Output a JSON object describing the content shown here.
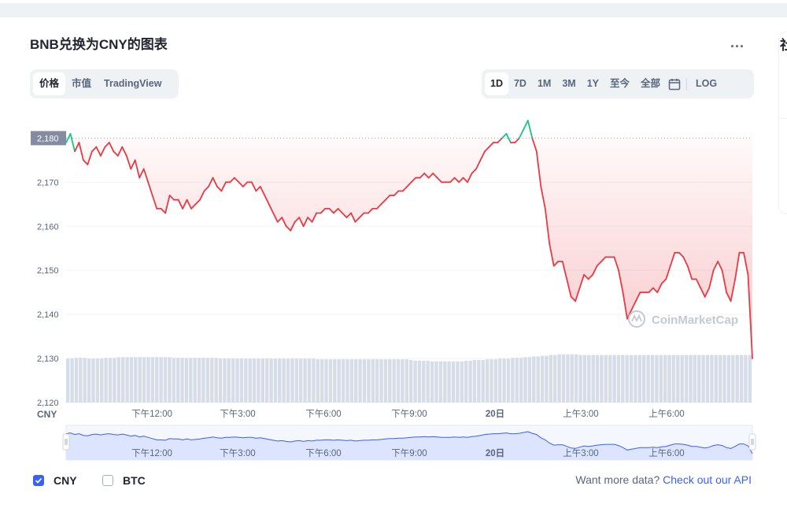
{
  "header": {
    "title": "BNB兑换为CNY的图表",
    "more_label": "..."
  },
  "view_tabs": [
    {
      "label": "价格",
      "active": true
    },
    {
      "label": "市值",
      "active": false
    },
    {
      "label": "TradingView",
      "active": false
    }
  ],
  "range_tabs": [
    {
      "label": "1D",
      "active": true
    },
    {
      "label": "7D",
      "active": false
    },
    {
      "label": "1M",
      "active": false
    },
    {
      "label": "3M",
      "active": false
    },
    {
      "label": "1Y",
      "active": false
    },
    {
      "label": "至今",
      "active": false
    },
    {
      "label": "全部",
      "active": false
    }
  ],
  "calendar_icon": "calendar-icon",
  "log_label": "LOG",
  "right_panel_title": "社",
  "footer": {
    "cny_label": "CNY",
    "btc_label": "BTC",
    "cny_checked": true,
    "btc_checked": false,
    "api_text": "Want more data? ",
    "api_link": "Check out our API"
  },
  "chart_data": {
    "type": "line",
    "watermark": "CoinMarketCap",
    "y_unit_label": "CNY",
    "ylim": [
      2120,
      2184
    ],
    "reference_value": 2180,
    "reference_label": "2,180",
    "y_ticks": [
      {
        "value": 2170,
        "label": "2,170"
      },
      {
        "value": 2160,
        "label": "2,160"
      },
      {
        "value": 2150,
        "label": "2,150"
      },
      {
        "value": 2140,
        "label": "2,140"
      },
      {
        "value": 2130,
        "label": "2,130"
      },
      {
        "value": 2120,
        "label": "2,120"
      }
    ],
    "x_ticks": [
      "下午12:00",
      "下午3:00",
      "下午6:00",
      "下午9:00",
      "20日",
      "上午3:00",
      "上午6:00"
    ],
    "x_tick_bold": [
      false,
      false,
      false,
      false,
      true,
      false,
      false
    ],
    "x_tick_hours": [
      3,
      6,
      9,
      12,
      15,
      18,
      21
    ],
    "x_range_hours": [
      0,
      24
    ],
    "colors": {
      "above": "#16c784",
      "below": "#ea3943",
      "fill": "#ea3943",
      "volume": "#cfd6e4",
      "nav_line": "#3861fb",
      "nav_fill": "#dde4fd"
    },
    "series": [
      {
        "values": [
          2179,
          2181,
          2177,
          2179,
          2175,
          2174,
          2177,
          2178,
          2176,
          2178,
          2179,
          2177,
          2176,
          2178,
          2176,
          2173,
          2175,
          2171,
          2173,
          2170,
          2167,
          2164,
          2164,
          2163,
          2167,
          2166,
          2166,
          2164,
          2166,
          2164,
          2165,
          2166,
          2168,
          2169,
          2171,
          2169,
          2168,
          2170,
          2170,
          2171,
          2170,
          2169,
          2170,
          2170,
          2168,
          2169,
          2167,
          2165,
          2163,
          2161,
          2162,
          2160,
          2159,
          2161,
          2162,
          2160,
          2162,
          2161,
          2163,
          2163,
          2164,
          2164,
          2163,
          2164,
          2163,
          2162,
          2163,
          2161,
          2162,
          2163,
          2163,
          2164,
          2164,
          2165,
          2166,
          2167,
          2167,
          2168,
          2168,
          2169,
          2170,
          2171,
          2171,
          2172,
          2171,
          2172,
          2171,
          2170,
          2170,
          2170,
          2171,
          2170,
          2171,
          2170,
          2172,
          2173,
          2175,
          2177,
          2178,
          2179,
          2179,
          2180,
          2181,
          2179,
          2179,
          2180,
          2182,
          2184,
          2180,
          2177,
          2169,
          2164,
          2156,
          2151,
          2152,
          2152,
          2148,
          2144,
          2143,
          2146,
          2149,
          2148,
          2149,
          2151,
          2152,
          2153,
          2153,
          2153,
          2150,
          2145,
          2139,
          2141,
          2143,
          2145,
          2145,
          2145,
          2146,
          2145,
          2147,
          2148,
          2151,
          2154,
          2154,
          2153,
          2151,
          2148,
          2148,
          2146,
          2144,
          2146,
          2150,
          2152,
          2150,
          2145,
          2143,
          2148,
          2154,
          2154,
          2149,
          2130
        ]
      }
    ],
    "volume": [
      0.62,
      0.62,
      0.63,
      0.63,
      0.63,
      0.62,
      0.62,
      0.62,
      0.62,
      0.63,
      0.63,
      0.63,
      0.64,
      0.64,
      0.64,
      0.64,
      0.64,
      0.64,
      0.64,
      0.64,
      0.64,
      0.64,
      0.64,
      0.64,
      0.64,
      0.63,
      0.63,
      0.63,
      0.63,
      0.63,
      0.63,
      0.63,
      0.63,
      0.63,
      0.63,
      0.63,
      0.62,
      0.62,
      0.62,
      0.62,
      0.62,
      0.62,
      0.62,
      0.62,
      0.62,
      0.62,
      0.62,
      0.62,
      0.62,
      0.62,
      0.62,
      0.62,
      0.62,
      0.62,
      0.62,
      0.62,
      0.62,
      0.62,
      0.62,
      0.61,
      0.61,
      0.61,
      0.61,
      0.61,
      0.61,
      0.61,
      0.61,
      0.61,
      0.61,
      0.61,
      0.61,
      0.61,
      0.61,
      0.61,
      0.61,
      0.61,
      0.61,
      0.61,
      0.61,
      0.61,
      0.61,
      0.6,
      0.59,
      0.59,
      0.59,
      0.59,
      0.58,
      0.58,
      0.58,
      0.58,
      0.58,
      0.58,
      0.58,
      0.58,
      0.59,
      0.59,
      0.6,
      0.6,
      0.6,
      0.61,
      0.61,
      0.61,
      0.62,
      0.62,
      0.62,
      0.63,
      0.63,
      0.63,
      0.64,
      0.64,
      0.65,
      0.65,
      0.66,
      0.66,
      0.67,
      0.67,
      0.68,
      0.68,
      0.68,
      0.68,
      0.68,
      0.67,
      0.67,
      0.67,
      0.67,
      0.67,
      0.67,
      0.67,
      0.67,
      0.67,
      0.67,
      0.67,
      0.67,
      0.67,
      0.67,
      0.67,
      0.67,
      0.67,
      0.67,
      0.67,
      0.67,
      0.67,
      0.67,
      0.67,
      0.67,
      0.67,
      0.67,
      0.67,
      0.67,
      0.67,
      0.67,
      0.67,
      0.67,
      0.67,
      0.67,
      0.67,
      0.67,
      0.67,
      0.67,
      0.67,
      0.67,
      0.67
    ]
  }
}
